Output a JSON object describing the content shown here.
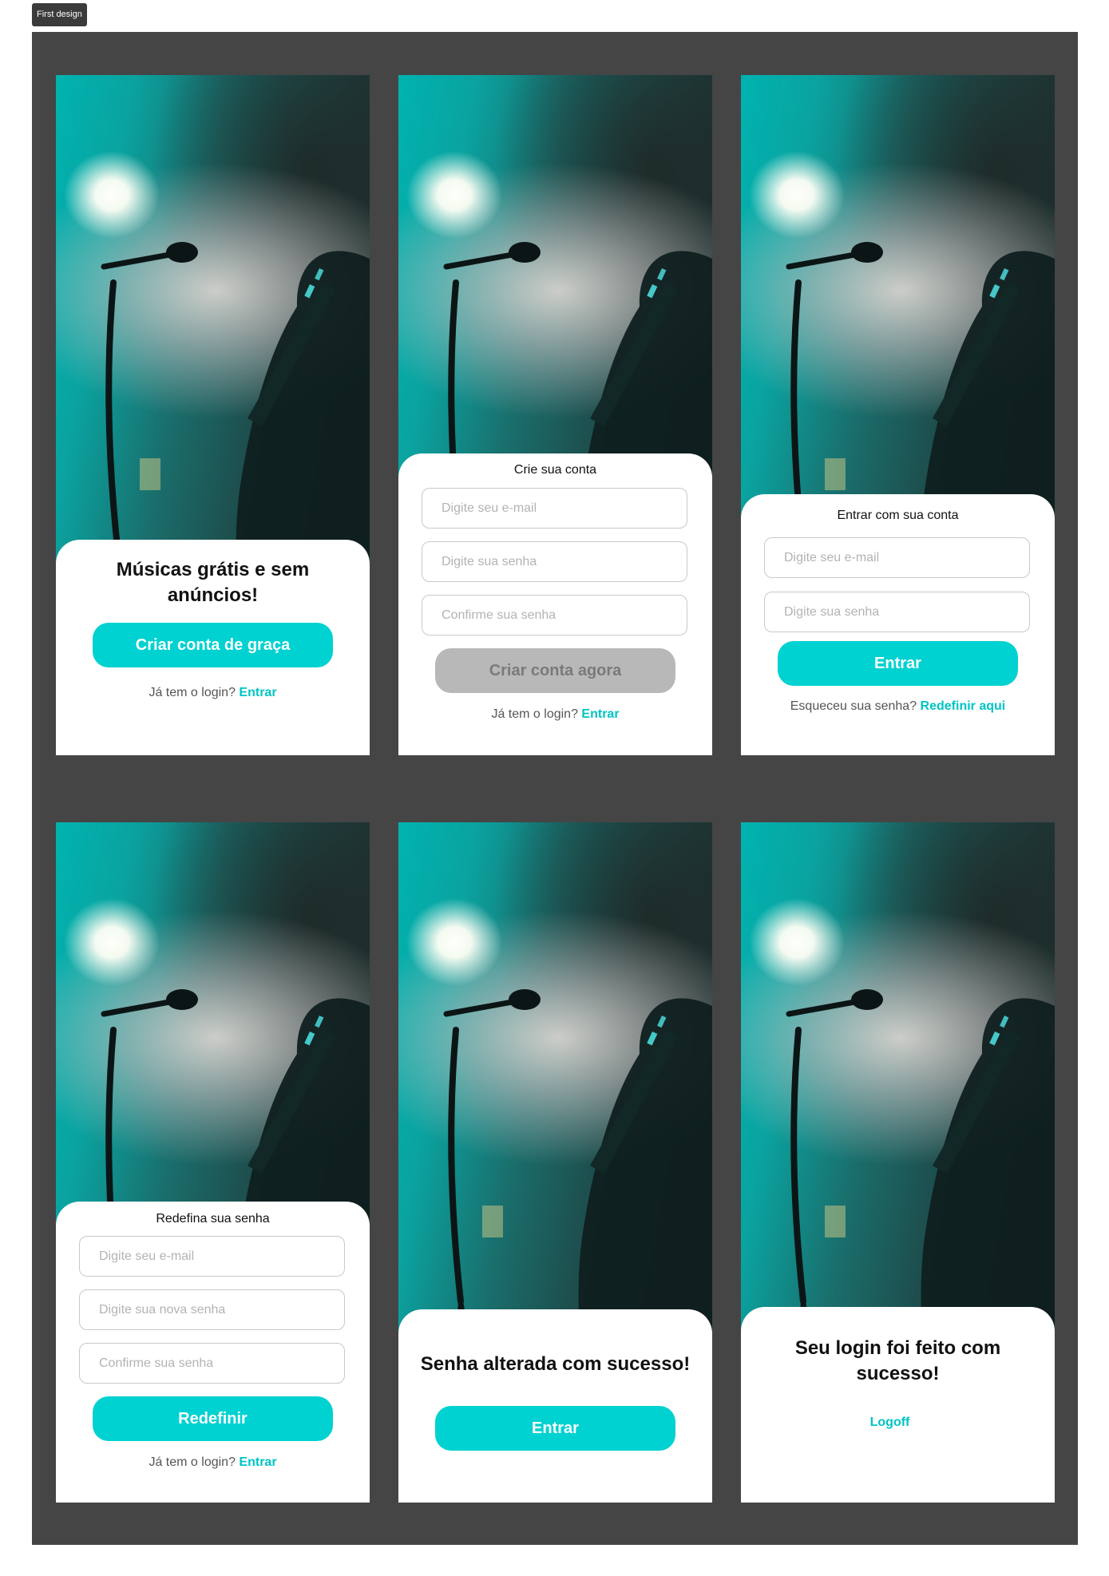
{
  "frame_label": "First design",
  "colors": {
    "accent": "#00d1d1",
    "canvas": "#454545",
    "disabled": "#b8b8b8"
  },
  "screens": {
    "welcome": {
      "title": "Músicas grátis e sem anúncios!",
      "cta": "Criar conta de graça",
      "footer_text": "Já tem o login?",
      "footer_link": "Entrar"
    },
    "signup": {
      "title": "Crie sua conta",
      "email_placeholder": "Digite seu e-mail",
      "password_placeholder": "Digite sua senha",
      "confirm_placeholder": "Confirme sua senha",
      "cta": "Criar conta agora",
      "footer_text": "Já tem o login?",
      "footer_link": "Entrar"
    },
    "login": {
      "title": "Entrar com sua conta",
      "email_placeholder": "Digite seu e-mail",
      "password_placeholder": "Digite sua senha",
      "cta": "Entrar",
      "footer_text": "Esqueceu sua senha?",
      "footer_link": "Redefinir aqui"
    },
    "reset": {
      "title": "Redefina sua senha",
      "email_placeholder": "Digite seu e-mail",
      "new_password_placeholder": "Digite sua nova senha",
      "confirm_placeholder": "Confirme sua senha",
      "cta": "Redefinir",
      "footer_text": "Já tem o login?",
      "footer_link": "Entrar"
    },
    "reset_success": {
      "title": "Senha alterada com sucesso!",
      "cta": "Entrar"
    },
    "login_success": {
      "title": "Seu login foi feito com sucesso!",
      "link": "Logoff"
    }
  }
}
